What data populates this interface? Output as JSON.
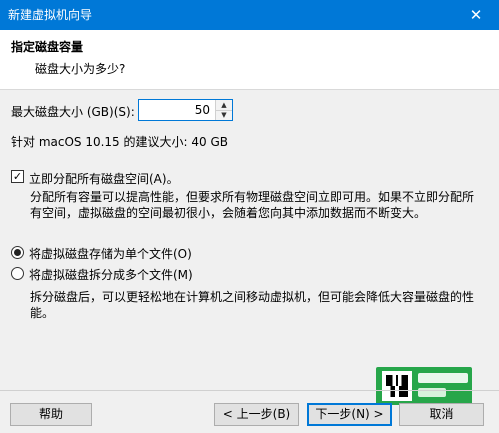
{
  "window": {
    "title": "新建虚拟机向导",
    "close_glyph": "✕"
  },
  "header": {
    "title": "指定磁盘容量",
    "subtitle": "磁盘大小为多少?"
  },
  "disk_size": {
    "label": "最大磁盘大小 (GB)(S):",
    "value": "50",
    "recommendation": "针对 macOS 10.15 的建议大小: 40 GB"
  },
  "allocate": {
    "label": "立即分配所有磁盘空间(A)。",
    "checked": true,
    "description": "分配所有容量可以提高性能，但要求所有物理磁盘空间立即可用。如果不立即分配所有空间，虚拟磁盘的空间最初很小，会随着您向其中添加数据而不断变大。"
  },
  "storage": {
    "single_label": "将虚拟磁盘存储为单个文件(O)",
    "multi_label": "将虚拟磁盘拆分成多个文件(M)",
    "selected": "single",
    "multi_description": "拆分磁盘后，可以更轻松地在计算机之间移动虚拟机，但可能会降低大容量磁盘的性能。"
  },
  "buttons": {
    "help": "帮助",
    "back": "< 上一步(B)",
    "next": "下一步(N) >",
    "cancel": "取消"
  },
  "icons": {
    "spin_up": "▲",
    "spin_down": "▼",
    "check": "✓"
  },
  "colors": {
    "titlebar": "#0078d7",
    "focus": "#0078d7",
    "widget_green": "#27a64a"
  }
}
